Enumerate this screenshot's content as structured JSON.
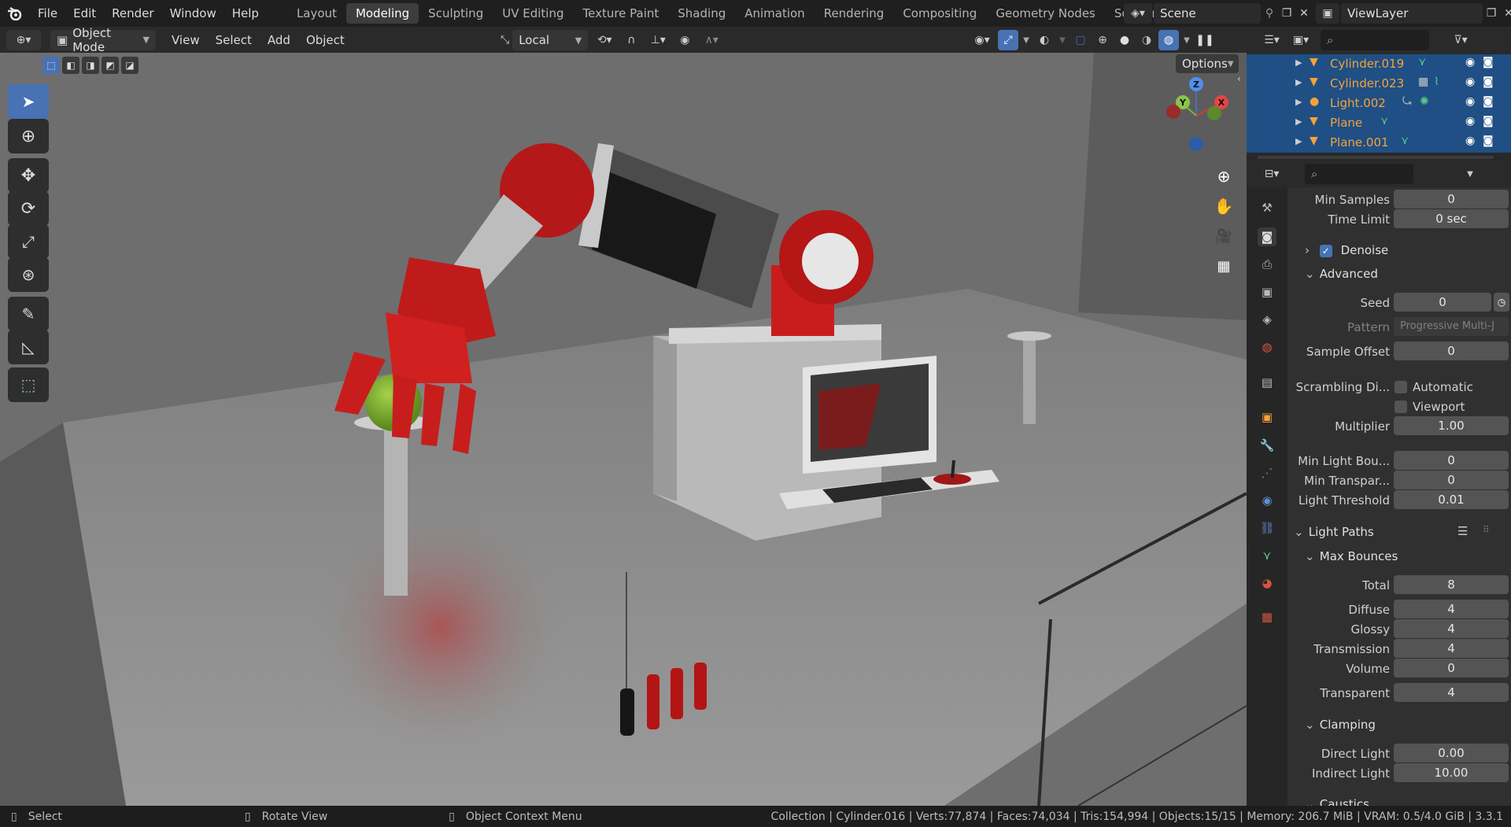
{
  "topbar": {
    "menus": [
      "File",
      "Edit",
      "Render",
      "Window",
      "Help"
    ],
    "workspaces": [
      "Layout",
      "Modeling",
      "Sculpting",
      "UV Editing",
      "Texture Paint",
      "Shading",
      "Animation",
      "Rendering",
      "Compositing",
      "Geometry Nodes",
      "Scripting"
    ],
    "active_workspace": "Modeling",
    "scene": "Scene",
    "view_layer": "ViewLayer"
  },
  "viewport_header": {
    "mode": "Object Mode",
    "menus": [
      "View",
      "Select",
      "Add",
      "Object"
    ],
    "transform_orientation": "Local",
    "options_label": "Options"
  },
  "outliner": {
    "items": [
      {
        "name": "Cylinder.019"
      },
      {
        "name": "Cylinder.023"
      },
      {
        "name": "Light.002"
      },
      {
        "name": "Plane"
      },
      {
        "name": "Plane.001"
      }
    ]
  },
  "properties": {
    "min_samples": {
      "label": "Min Samples",
      "value": "0"
    },
    "time_limit": {
      "label": "Time Limit",
      "value": "0 sec"
    },
    "denoise": {
      "label": "Denoise",
      "checked": true
    },
    "advanced": {
      "label": "Advanced"
    },
    "seed": {
      "label": "Seed",
      "value": "0"
    },
    "pattern": {
      "label": "Pattern",
      "value": "Progressive Multi-J"
    },
    "sample_offset": {
      "label": "Sample Offset",
      "value": "0"
    },
    "scrambling": {
      "label": "Scrambling Di...",
      "automatic": "Automatic",
      "viewport": "Viewport"
    },
    "multiplier": {
      "label": "Multiplier",
      "value": "1.00"
    },
    "min_light_bounces": {
      "label": "Min Light Bou...",
      "value": "0"
    },
    "min_transparent": {
      "label": "Min Transpar...",
      "value": "0"
    },
    "light_threshold": {
      "label": "Light Threshold",
      "value": "0.01"
    },
    "light_paths": {
      "label": "Light Paths"
    },
    "max_bounces": {
      "label": "Max Bounces"
    },
    "total": {
      "label": "Total",
      "value": "8"
    },
    "diffuse": {
      "label": "Diffuse",
      "value": "4"
    },
    "glossy": {
      "label": "Glossy",
      "value": "4"
    },
    "transmission": {
      "label": "Transmission",
      "value": "4"
    },
    "volume": {
      "label": "Volume",
      "value": "0"
    },
    "transparent": {
      "label": "Transparent",
      "value": "4"
    },
    "clamping": {
      "label": "Clamping"
    },
    "direct_light": {
      "label": "Direct Light",
      "value": "0.00"
    },
    "indirect_light": {
      "label": "Indirect Light",
      "value": "10.00"
    },
    "caustics": {
      "label": "Caustics"
    }
  },
  "gizmo": {
    "x": "X",
    "y": "Y",
    "z": "Z"
  },
  "statusbar": {
    "select": "Select",
    "rotate": "Rotate View",
    "context": "Object Context Menu",
    "info": "Collection | Cylinder.016 | Verts:77,874 | Faces:74,034 | Tris:154,994 | Objects:15/15 | Memory: 206.7 MiB | VRAM: 0.5/4.0 GiB | 3.3.1"
  },
  "colors": {
    "accent": "#4772b3",
    "object_highlight": "#f6a23a",
    "outliner_selected": "#1f4f84"
  }
}
